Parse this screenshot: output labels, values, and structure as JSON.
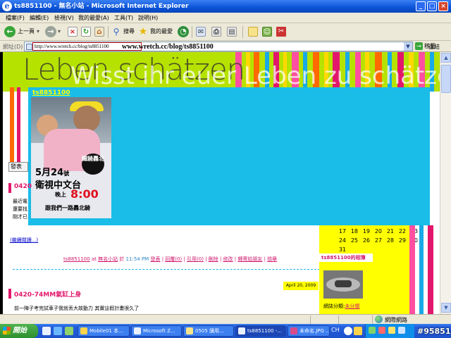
{
  "window": {
    "title": "ts8851100 - 無名小站 - Microsoft Internet Explorer",
    "buttons": {
      "minimize": "_",
      "maximize": "□",
      "close": "×"
    }
  },
  "menu": [
    "檔案(F)",
    "編輯(E)",
    "檢視(V)",
    "我的最愛(A)",
    "工具(T)",
    "說明(H)"
  ],
  "toolbar": {
    "back": "上一頁",
    "search": "搜尋",
    "favorites": "我的最愛"
  },
  "address": {
    "label": "網址(D)",
    "url_typed": "http://www.wretch.cc/blog/ts8851100",
    "url_large": "www.wretch.cc/blog/ts8851100",
    "go": "移至",
    "links": "連結"
  },
  "banner": {
    "line1": "Leben schätzen",
    "line2": "Wisst ihr euer Leben zu schätzen?",
    "blog_name": "ts8851100"
  },
  "poster": {
    "date_num": "5月24",
    "date_suffix": "號",
    "channel": "衛視中文台",
    "time_prefix": "晚上",
    "time": "8:00",
    "slogan": "跟我們一路轟北騎",
    "bubble_text": "鐵騎轟北"
  },
  "content": {
    "side_button": "發表",
    "post1_title_fragment": "0420",
    "post1_lines": [
      "最近電",
      "還要找",
      "剛才已"
    ],
    "read_more": "(繼續閱讀...)",
    "meta": {
      "author": "ts8851100",
      "at": "at",
      "site": "無名小站",
      "on": "於",
      "time": "11:54 PM",
      "publish": "發表",
      "links": [
        "回覆(0)",
        "引用(0)",
        "刪除",
        "修改",
        "轉寄給朋友",
        "檢舉"
      ]
    },
    "post2_date": "April 20, 2009",
    "post2_title": "0420-74MM氣缸上身",
    "post2_body": "前一陣子考完試車子我就丟大故動力 其實這假計畫很久了"
  },
  "sidebar": {
    "calendar_rows": [
      [
        "17",
        "18",
        "19",
        "20",
        "21",
        "22",
        "23"
      ],
      [
        "24",
        "25",
        "26",
        "27",
        "28",
        "29",
        "30"
      ],
      [
        "31"
      ]
    ],
    "album_header": "ts8851100的相簿",
    "album_category_label": "網誌分類:",
    "album_category_value": "未分類"
  },
  "statusbar": {
    "zone": "網際網路"
  },
  "taskbar": {
    "start": "開始",
    "tasks": [
      "Mobile01 本...",
      "Microsoft Z...",
      "0505 讀用...",
      "ts8851100 -...",
      "未命名.JPG ..."
    ],
    "lang": "CH",
    "watermark": "#958516"
  },
  "colors": {
    "accent_pink": "#e2176c",
    "cyan": "#19bde8",
    "yellow": "#ffff00",
    "lime": "#b6e200"
  }
}
